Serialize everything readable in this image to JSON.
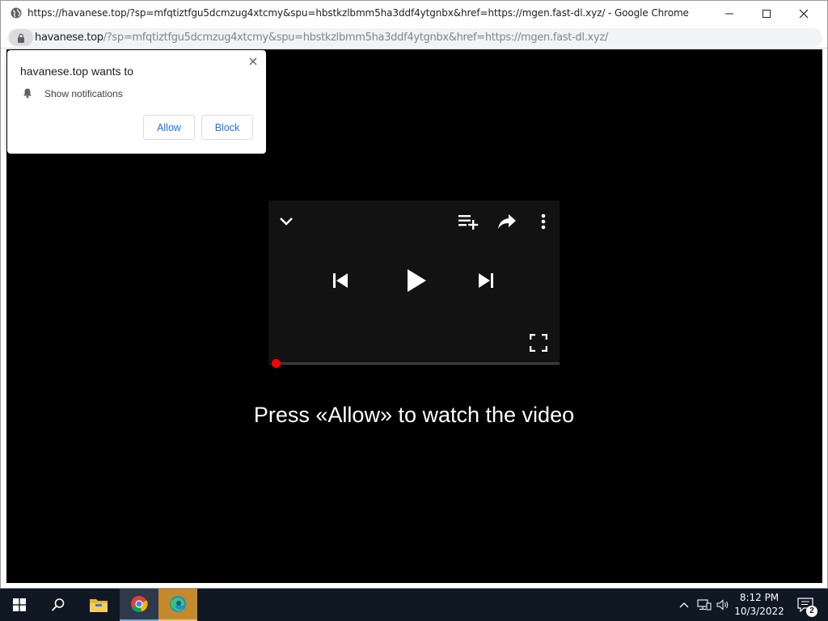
{
  "window": {
    "title": "https://havanese.top/?sp=mfqtiztfgu5dcmzug4xtcmy&spu=hbstkzlbmm5ha3ddf4ytgnbx&href=https://mgen.fast-dl.xyz/ - Google Chrome",
    "controls": [
      "minimize-icon",
      "maximize-icon",
      "close-icon"
    ]
  },
  "address_bar": {
    "host": "havanese.top",
    "path": "/?sp=mfqtiztfgu5dcmzug4xtcmy&spu=hbstkzlbmm5ha3ddf4ytgnbx&href=https://mgen.fast-dl.xyz/",
    "icon": "lock-icon"
  },
  "permission_prompt": {
    "title": "havanese.top wants to",
    "item": "Show notifications",
    "allow_label": "Allow",
    "block_label": "Block"
  },
  "player": {
    "progress": 0,
    "icons": [
      "chevron-down-icon",
      "add-to-queue-icon",
      "share-icon",
      "more-vert-icon",
      "skip-previous-icon",
      "play-icon",
      "skip-next-icon",
      "fullscreen-icon"
    ]
  },
  "cta": "Press «Allow» to watch the video",
  "taskbar": {
    "time": "8:12 PM",
    "date": "10/3/2022",
    "notification_count": "2"
  },
  "colors": {
    "accent": "#1a73e8",
    "progress": "#ff0000",
    "taskbar": "#101824"
  }
}
